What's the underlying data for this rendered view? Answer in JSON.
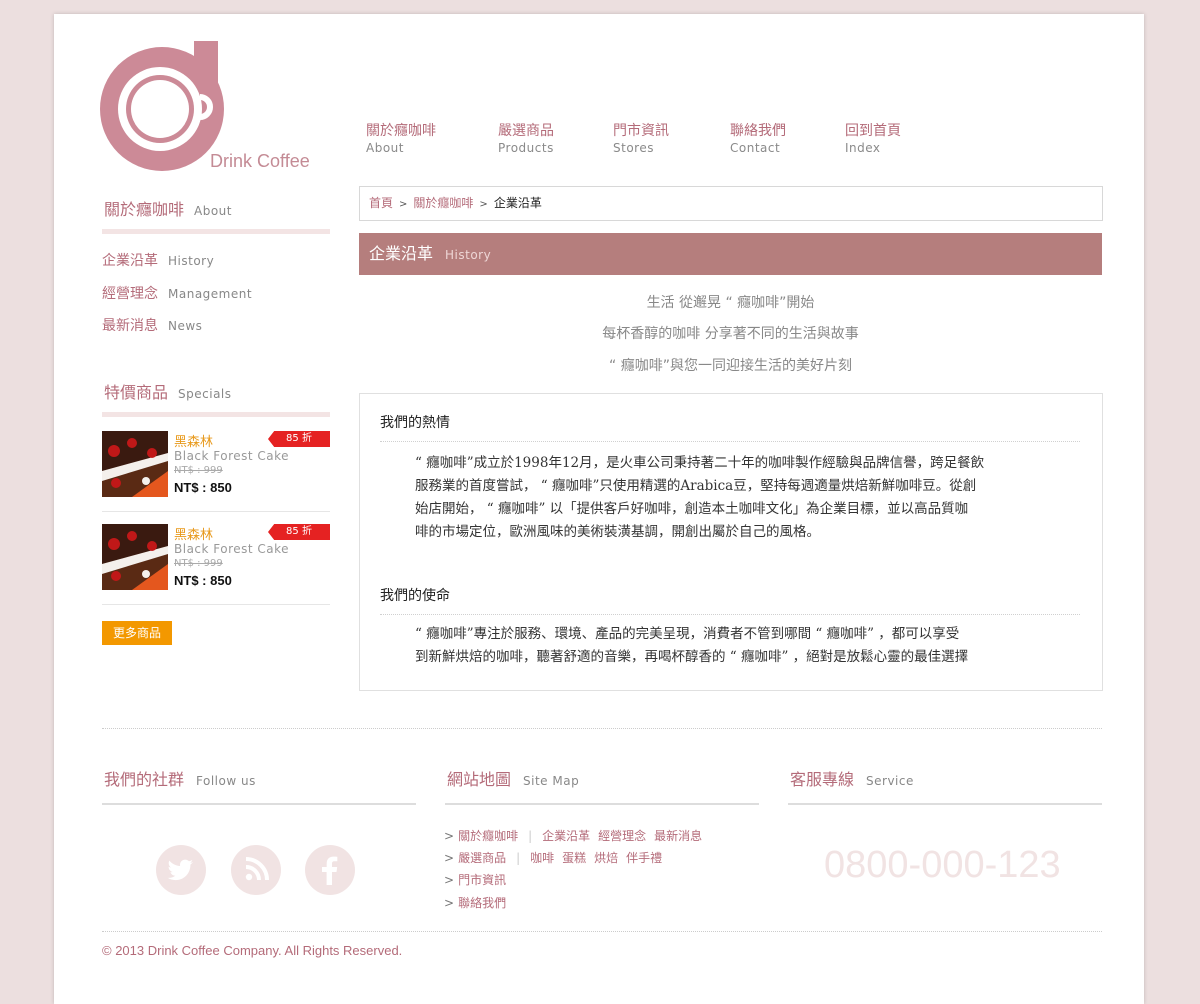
{
  "brand": {
    "logo_text": "Drink Coffee"
  },
  "nav": [
    {
      "zh": "關於癮咖啡",
      "en": "About"
    },
    {
      "zh": "嚴選商品",
      "en": "Products"
    },
    {
      "zh": "門市資訊",
      "en": "Stores"
    },
    {
      "zh": "聯絡我們",
      "en": "Contact"
    },
    {
      "zh": "回到首頁",
      "en": "Index"
    }
  ],
  "sidebar": {
    "about_head": {
      "zh": "關於癮咖啡",
      "en": "About"
    },
    "links": [
      {
        "zh": "企業沿革",
        "en": "History"
      },
      {
        "zh": "經營理念",
        "en": "Management"
      },
      {
        "zh": "最新消息",
        "en": "News"
      }
    ],
    "specials_head": {
      "zh": "特價商品",
      "en": "Specials"
    },
    "products": [
      {
        "name": "黑森林",
        "badge": "85 折",
        "en": "Black Forest Cake",
        "old_price": "NT$ : 999",
        "price": "NT$ : 850"
      },
      {
        "name": "黑森林",
        "badge": "85 折",
        "en": "Black Forest Cake",
        "old_price": "NT$ : 999",
        "price": "NT$ : 850"
      }
    ],
    "more_label": "更多商品"
  },
  "breadcrumb": {
    "home": "首頁",
    "parent": "關於癮咖啡",
    "current": "企業沿革"
  },
  "section": {
    "zh": "企業沿革",
    "en": "History"
  },
  "slogans": [
    "生活  從邂晃 “ 癮咖啡”開始",
    "每杯香醇的咖啡 分享著不同的生活與故事",
    "“ 癮咖啡”與您一同迎接生活的美好片刻"
  ],
  "content": {
    "passion_head": "我們的熱情",
    "passion_lines": [
      "“ 癮咖啡”成立於1998年12月，是火車公司秉持著二十年的咖啡製作經驗與品牌信譽，跨足餐飲",
      "服務業的首度嘗試， “ 癮咖啡”只使用精選的Arabica豆，堅持每週適量烘焙新鮮咖啡豆。從創",
      "始店開始， “ 癮咖啡” 以「提供客戶好咖啡，創造本土咖啡文化」為企業目標，並以高品質咖",
      "啡的市場定位，歐洲風味的美術裝潢基調，開創出屬於自己的風格。"
    ],
    "mission_head": "我們的使命",
    "mission_lines": [
      "“ 癮咖啡”專注於服務、環境、產品的完美呈現，消費者不管到哪間 “ 癮咖啡” ，都可以享受",
      "到新鮮烘焙的咖啡，聽著舒適的音樂，再喝杯醇香的 “ 癮咖啡” ，絕對是放鬆心靈的最佳選擇"
    ]
  },
  "footer": {
    "social_head": {
      "zh": "我們的社群",
      "en": "Follow us"
    },
    "sitemap_head": {
      "zh": "網站地圖",
      "en": "Site Map"
    },
    "service_head": {
      "zh": "客服專線",
      "en": "Service"
    },
    "social_icons": [
      "twitter-icon",
      "rss-icon",
      "facebook-icon"
    ],
    "sitemap": {
      "row1_main": "關於癮咖啡",
      "row1_subs": [
        "企業沿革",
        "經營理念",
        "最新消息"
      ],
      "row2_main": "嚴選商品",
      "row2_subs": [
        "咖啡",
        "蛋糕",
        "烘焙",
        "伴手禮"
      ],
      "row3_main": "門市資訊",
      "row4_main": "聯絡我們",
      "arrow": ">"
    },
    "phone": "0800-000-123",
    "copyright": "© 2013 Drink Coffee Company. All Rights Reserved."
  },
  "colors": {
    "accent": "#b46b79",
    "banner": "#b57e7d",
    "orange": "#f39800",
    "badge": "#e52222",
    "bg": "#ecdfdf"
  }
}
